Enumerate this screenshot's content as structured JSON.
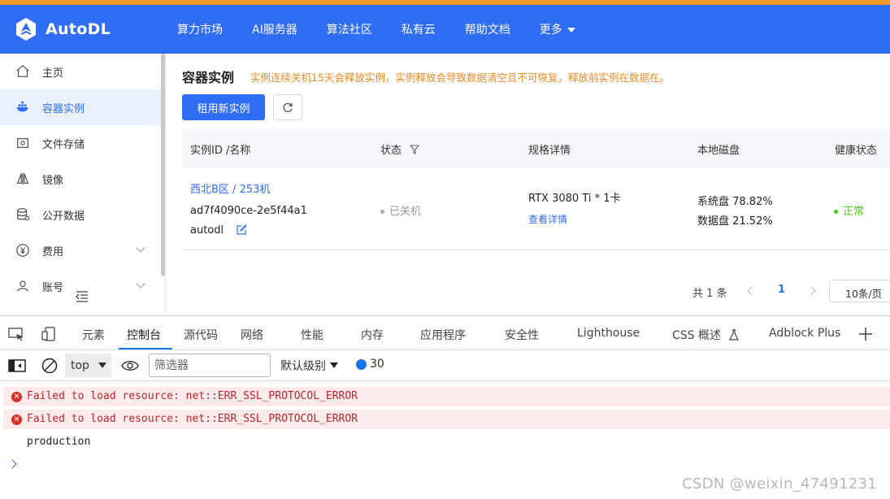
{
  "app": {
    "name": "AutoDL"
  },
  "nav": {
    "items": [
      "算力市场",
      "AI服务器",
      "算法社区",
      "私有云",
      "帮助文档"
    ],
    "more_label": "更多"
  },
  "sidebar": {
    "items": [
      {
        "label": "主页",
        "icon": "home-icon"
      },
      {
        "label": "容器实例",
        "icon": "container-icon",
        "active": true
      },
      {
        "label": "文件存储",
        "icon": "storage-icon"
      },
      {
        "label": "镜像",
        "icon": "image-icon"
      },
      {
        "label": "公开数据",
        "icon": "database-icon"
      },
      {
        "label": "费用",
        "icon": "yen-icon",
        "expandable": true
      },
      {
        "label": "账号",
        "icon": "user-icon",
        "expandable": true
      }
    ]
  },
  "main": {
    "title": "容器实例",
    "warning": "实例连续关机15天会释放实例，实例释放会导致数据清空且不可恢复，释放前实例在数据在。",
    "new_instance_button": "租用新实例",
    "table": {
      "headers": {
        "id_name": "实例ID /名称",
        "status": "状态",
        "spec": "规格详情",
        "disk": "本地磁盘",
        "health": "健康状态"
      },
      "rows": [
        {
          "region_machine": "西北B区 / 253机",
          "instance_id": "ad7f4090ce-2e5f44a1",
          "name": "autodl",
          "status": "已关机",
          "spec": "RTX 3080 Ti * 1卡",
          "spec_link": "查看详情",
          "system_disk": "系统盘 78.82%",
          "data_disk": "数据盘 21.52%",
          "health": "正常"
        }
      ]
    },
    "pagination": {
      "total": "共 1 条",
      "current_page": "1",
      "page_size": "10条/页"
    }
  },
  "devtools": {
    "tabs": [
      "元素",
      "控制台",
      "源代码",
      "网络",
      "性能",
      "内存",
      "应用程序",
      "安全性",
      "Lighthouse",
      "CSS 概述",
      "Adblock Plus"
    ],
    "active_tab": "控制台",
    "context": "top",
    "filter_placeholder": "筛选器",
    "level": "默认级别",
    "message_count": "30",
    "console": [
      {
        "type": "error",
        "text": "Failed to load resource: net::ERR_SSL_PROTOCOL_ERROR"
      },
      {
        "type": "error",
        "text": "Failed to load resource: net::ERR_SSL_PROTOCOL_ERROR"
      },
      {
        "type": "log",
        "text": "production"
      }
    ]
  },
  "watermark": "CSDN @weixin_47491231",
  "colors": {
    "brand": "#2f6df6",
    "accent": "#f39c2b",
    "warning": "#f08a24",
    "ok": "#52c41a",
    "error": "#d93025"
  }
}
